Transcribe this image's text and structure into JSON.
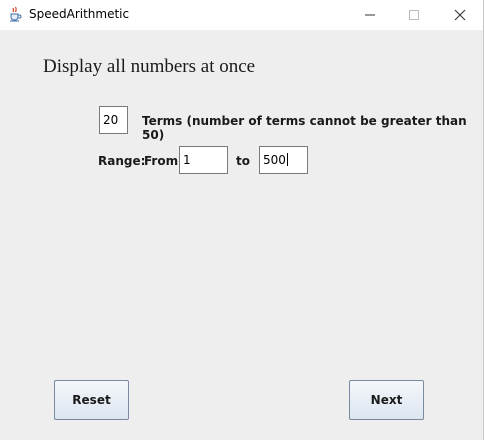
{
  "window": {
    "title": "SpeedArithmetic",
    "icon": "java-cup-icon",
    "controls": [
      "minimize-icon",
      "maximize-icon",
      "close-icon"
    ]
  },
  "main": {
    "heading": "Display all numbers at once",
    "terms": {
      "value": "20",
      "label": "Terms (number of terms cannot be greater than 50)"
    },
    "range": {
      "label": "Range:",
      "from_label": "From",
      "from_value": "1",
      "to_label": "to",
      "to_value": "500"
    }
  },
  "buttons": {
    "reset": "Reset",
    "next": "Next"
  }
}
